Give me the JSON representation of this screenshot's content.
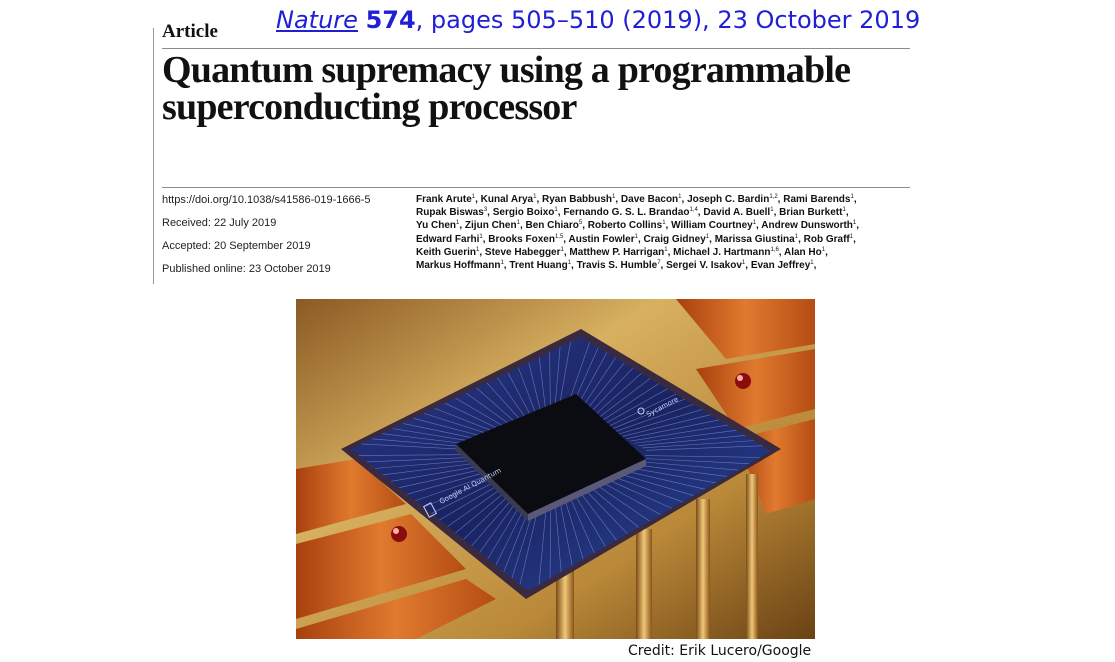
{
  "header": {
    "article_label": "Article",
    "citation": {
      "journal": "Nature",
      "volume": "574",
      "pages": ", pages 505–510 (2019), 23 October 2019"
    }
  },
  "title": {
    "line1": "Quantum supremacy using a programmable",
    "line2": "superconducting processor"
  },
  "meta": {
    "doi": "https://doi.org/10.1038/s41586-019-1666-5",
    "received": "Received: 22 July 2019",
    "accepted": "Accepted: 20 September 2019",
    "published": "Published online: 23 October 2019"
  },
  "authors": [
    {
      "name": "Frank Arute",
      "aff": "1"
    },
    {
      "name": "Kunal Arya",
      "aff": "1"
    },
    {
      "name": "Ryan Babbush",
      "aff": "1"
    },
    {
      "name": "Dave Bacon",
      "aff": "1"
    },
    {
      "name": "Joseph C. Bardin",
      "aff": "1,2"
    },
    {
      "name": "Rami Barends",
      "aff": "1"
    },
    {
      "name": "Rupak Biswas",
      "aff": "3"
    },
    {
      "name": "Sergio Boixo",
      "aff": "1"
    },
    {
      "name": "Fernando G. S. L. Brandao",
      "aff": "1,4"
    },
    {
      "name": "David A. Buell",
      "aff": "1"
    },
    {
      "name": "Brian Burkett",
      "aff": "1"
    },
    {
      "name": "Yu Chen",
      "aff": "1"
    },
    {
      "name": "Zijun Chen",
      "aff": "1"
    },
    {
      "name": "Ben Chiaro",
      "aff": "5"
    },
    {
      "name": "Roberto Collins",
      "aff": "1"
    },
    {
      "name": "William Courtney",
      "aff": "1"
    },
    {
      "name": "Andrew Dunsworth",
      "aff": "1"
    },
    {
      "name": "Edward Farhi",
      "aff": "1"
    },
    {
      "name": "Brooks Foxen",
      "aff": "1,5"
    },
    {
      "name": "Austin Fowler",
      "aff": "1"
    },
    {
      "name": "Craig Gidney",
      "aff": "1"
    },
    {
      "name": "Marissa Giustina",
      "aff": "1"
    },
    {
      "name": "Rob Graff",
      "aff": "1"
    },
    {
      "name": "Keith Guerin",
      "aff": "1"
    },
    {
      "name": "Steve Habegger",
      "aff": "1"
    },
    {
      "name": "Matthew P. Harrigan",
      "aff": "1"
    },
    {
      "name": "Michael J. Hartmann",
      "aff": "1,6"
    },
    {
      "name": "Alan Ho",
      "aff": "1"
    },
    {
      "name": "Markus Hoffmann",
      "aff": "1"
    },
    {
      "name": "Trent Huang",
      "aff": "1"
    },
    {
      "name": "Travis S. Humble",
      "aff": "7"
    },
    {
      "name": "Sergei V. Isakov",
      "aff": "1"
    },
    {
      "name": "Evan Jeffrey",
      "aff": "1"
    }
  ],
  "author_lines": [
    6,
    5,
    6,
    6,
    5,
    5
  ],
  "photo": {
    "chip_left_label": "Google AI Quantum",
    "chip_right_label": "Sycamore",
    "colors": {
      "copper": "#d2641c",
      "gold": "#c8a254",
      "chip": "#1e2a6a",
      "die": "#0c0c14"
    }
  },
  "credit": "Credit: Erik Lucero/Google"
}
